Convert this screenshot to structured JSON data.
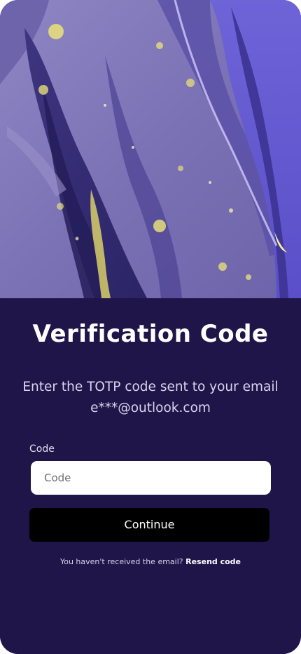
{
  "header": {
    "title": "Verification Code"
  },
  "instructions": {
    "line1": "Enter the TOTP code sent to your email",
    "email": "e***@outlook.com"
  },
  "form": {
    "code_label": "Code",
    "code_placeholder": "Code",
    "code_value": "",
    "continue_label": "Continue"
  },
  "footer": {
    "prompt": "You haven't received the email?",
    "resend_label": "Resend code"
  },
  "colors": {
    "panel_background": "#1f1549",
    "button_background": "#000000",
    "input_background": "#ffffff",
    "hero_purple": "#7e74b8",
    "hero_accent_yellow": "#e6d873"
  },
  "hero": {
    "image": "purple-marble-abstract"
  }
}
